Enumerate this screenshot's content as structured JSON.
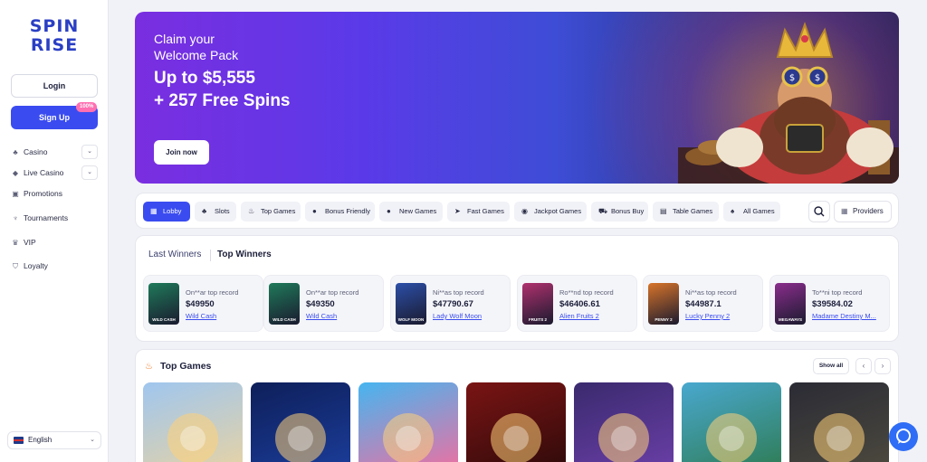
{
  "brand": {
    "logo_line1": "SPIN",
    "logo_line2": "RISE"
  },
  "auth": {
    "login_label": "Login",
    "signup_label": "Sign Up",
    "signup_badge": "100%"
  },
  "nav": [
    {
      "label": "Casino",
      "icon": "cards-icon",
      "expandable": true
    },
    {
      "label": "Live Casino",
      "icon": "diamond-icon",
      "expandable": true
    },
    {
      "label": "Promotions",
      "icon": "gift-icon",
      "expandable": false
    },
    {
      "label": "Tournaments",
      "icon": "trophy-icon",
      "expandable": false
    },
    {
      "label": "VIP",
      "icon": "crown-icon",
      "expandable": false
    },
    {
      "label": "Loyalty",
      "icon": "shield-icon",
      "expandable": false
    }
  ],
  "language": {
    "label": "English"
  },
  "hero": {
    "line1": "Claim your",
    "line2": "Welcome Pack",
    "line3": "Up to $5,555",
    "line4": "+ 257 Free Spins",
    "cta": "Join now"
  },
  "categories": [
    {
      "label": "Lobby",
      "icon": "lobby-icon",
      "active": true
    },
    {
      "label": "Slots",
      "icon": "cherries-icon",
      "active": false
    },
    {
      "label": "Top Games",
      "icon": "fire-icon",
      "active": false
    },
    {
      "label": "Bonus Friendly",
      "icon": "moneybag-icon",
      "active": false
    },
    {
      "label": "New Games",
      "icon": "new-icon",
      "active": false
    },
    {
      "label": "Fast Games",
      "icon": "rocket-icon",
      "active": false
    },
    {
      "label": "Jackpot Games",
      "icon": "coin-icon",
      "active": false
    },
    {
      "label": "Bonus Buy",
      "icon": "cart-icon",
      "active": false
    },
    {
      "label": "Table Games",
      "icon": "card-icon",
      "active": false
    },
    {
      "label": "All Games",
      "icon": "grid-icon",
      "active": false
    }
  ],
  "providers_label": "Providers",
  "winners": {
    "tab_last": "Last Winners",
    "tab_top": "Top Winners",
    "items": [
      {
        "record": "On**ar top record",
        "amount": "$49950",
        "game": "Wild Cash",
        "thumb_label": "WILD CASH",
        "thumb_color": "#1f7a5a"
      },
      {
        "record": "On**ar top record",
        "amount": "$49350",
        "game": "Wild Cash",
        "thumb_label": "WILD CASH",
        "thumb_color": "#1f7a5a"
      },
      {
        "record": "Ni**as top record",
        "amount": "$47790.67",
        "game": "Lady Wolf Moon",
        "thumb_label": "WOLF MOON",
        "thumb_color": "#2c4fa8"
      },
      {
        "record": "Ro**nd top record",
        "amount": "$46406.61",
        "game": "Alien Fruits 2",
        "thumb_label": "FRUITS 2",
        "thumb_color": "#b0316e"
      },
      {
        "record": "Ni**as top record",
        "amount": "$44987.1",
        "game": "Lucky Penny 2",
        "thumb_label": "PENNY 2",
        "thumb_color": "#d8742a"
      },
      {
        "record": "To**ni top record",
        "amount": "$39584.02",
        "game": "Madame Destiny M...",
        "thumb_label": "MEGAWAYS",
        "thumb_color": "#8a2d8c"
      }
    ]
  },
  "top_games": {
    "title": "Top Games",
    "show_all": "Show all",
    "tiles": [
      {
        "name": "zeus-game",
        "bg1": "#9fc6ef",
        "bg2": "#e8d3a3"
      },
      {
        "name": "golden-flower-game",
        "bg1": "#0e1f5a",
        "bg2": "#1b3d9a"
      },
      {
        "name": "candy-swirl-game",
        "bg1": "#46b5f0",
        "bg2": "#f06fa0"
      },
      {
        "name": "fortune-tree-game",
        "bg1": "#7a1414",
        "bg2": "#2e0a0a"
      },
      {
        "name": "treasure-pot-game",
        "bg1": "#3a2a6e",
        "bg2": "#6b3fa8"
      },
      {
        "name": "aztec-warrior-game",
        "bg1": "#49a8cf",
        "bg2": "#2e7b52"
      },
      {
        "name": "pyramid-game",
        "bg1": "#2b2b35",
        "bg2": "#4d4a3e"
      }
    ]
  }
}
